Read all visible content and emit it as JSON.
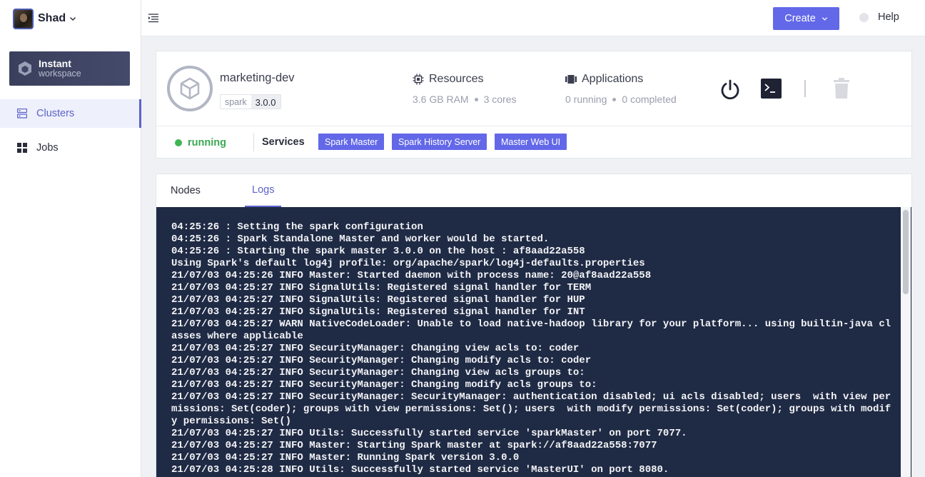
{
  "sidebar": {
    "user_name": "Shad",
    "workspace_title": "Instant",
    "workspace_subtitle": "workspace",
    "items": [
      {
        "label": "Clusters",
        "active": true
      },
      {
        "label": "Jobs",
        "active": false
      }
    ]
  },
  "topbar": {
    "create_label": "Create",
    "help_label": "Help"
  },
  "cluster": {
    "name": "marketing-dev",
    "tag_key": "spark",
    "tag_value": "3.0.0",
    "resources": {
      "title": "Resources",
      "ram": "3.6 GB RAM",
      "cores": "3 cores"
    },
    "applications": {
      "title": "Applications",
      "running": "0 running",
      "completed": "0 completed"
    },
    "status": "running",
    "services_label": "Services",
    "services": [
      "Spark Master",
      "Spark History Server",
      "Master Web UI"
    ]
  },
  "tabs": [
    {
      "label": "Nodes",
      "active": false
    },
    {
      "label": "Logs",
      "active": true
    }
  ],
  "logs": [
    "04:25:26 : Setting the spark configuration",
    "04:25:26 : Spark Standalone Master and worker would be started.",
    "04:25:26 : Starting the spark master 3.0.0 on the host : af8aad22a558",
    "Using Spark's default log4j profile: org/apache/spark/log4j-defaults.properties",
    "21/07/03 04:25:26 INFO Master: Started daemon with process name: 20@af8aad22a558",
    "21/07/03 04:25:27 INFO SignalUtils: Registered signal handler for TERM",
    "21/07/03 04:25:27 INFO SignalUtils: Registered signal handler for HUP",
    "21/07/03 04:25:27 INFO SignalUtils: Registered signal handler for INT",
    "21/07/03 04:25:27 WARN NativeCodeLoader: Unable to load native-hadoop library for your platform... using builtin-java classes where applicable",
    "21/07/03 04:25:27 INFO SecurityManager: Changing view acls to: coder",
    "21/07/03 04:25:27 INFO SecurityManager: Changing modify acls to: coder",
    "21/07/03 04:25:27 INFO SecurityManager: Changing view acls groups to:",
    "21/07/03 04:25:27 INFO SecurityManager: Changing modify acls groups to:",
    "21/07/03 04:25:27 INFO SecurityManager: SecurityManager: authentication disabled; ui acls disabled; users  with view permissions: Set(coder); groups with view permissions: Set(); users  with modify permissions: Set(coder); groups with modify permissions: Set()",
    "21/07/03 04:25:27 INFO Utils: Successfully started service 'sparkMaster' on port 7077.",
    "21/07/03 04:25:27 INFO Master: Starting Spark master at spark://af8aad22a558:7077",
    "21/07/03 04:25:27 INFO Master: Running Spark version 3.0.0",
    "21/07/03 04:25:28 INFO Utils: Successfully started service 'MasterUI' on port 8080."
  ]
}
